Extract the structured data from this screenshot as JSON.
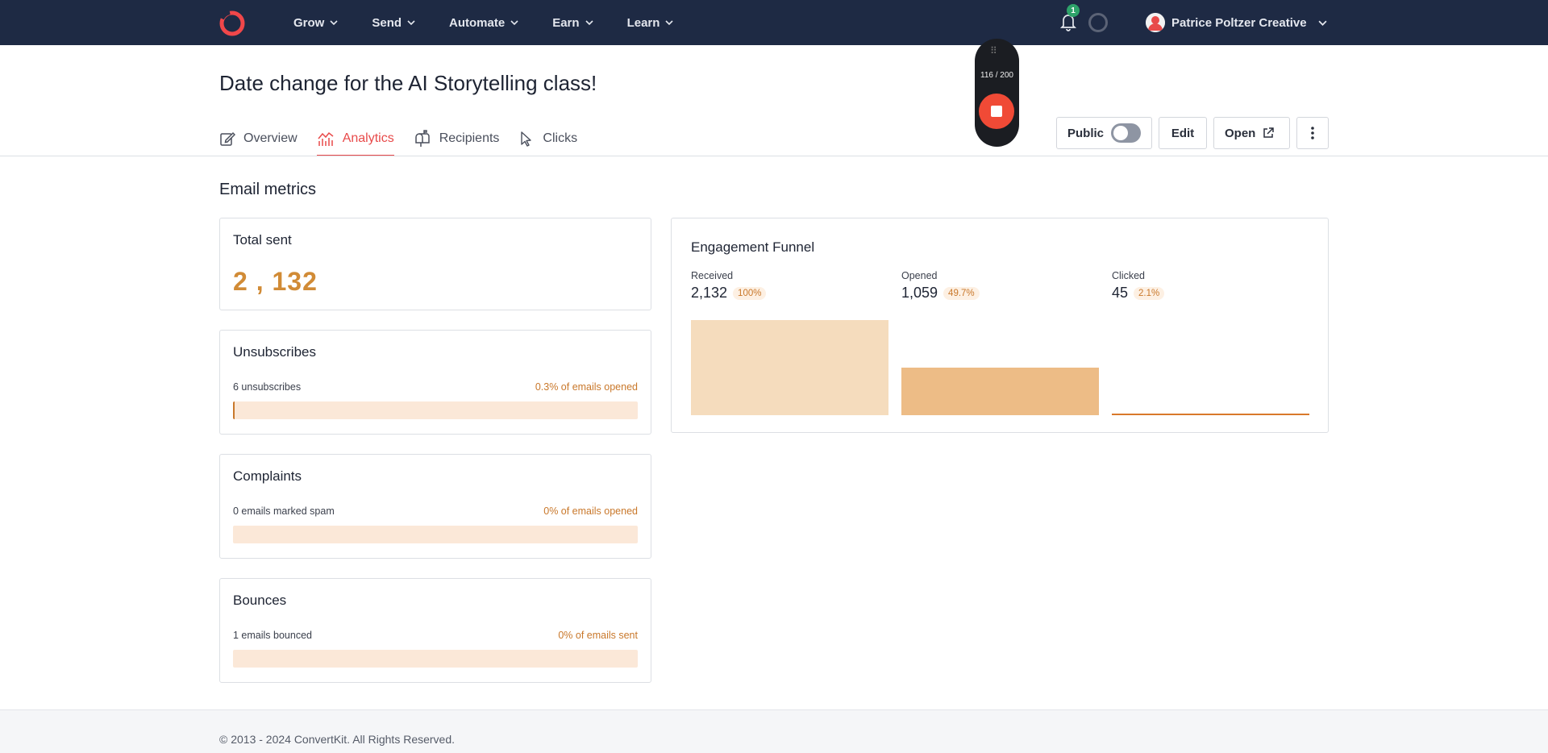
{
  "nav": {
    "items": [
      {
        "label": "Grow"
      },
      {
        "label": "Send"
      },
      {
        "label": "Automate"
      },
      {
        "label": "Earn"
      },
      {
        "label": "Learn"
      }
    ],
    "notification_count": "1",
    "user_name": "Patrice Poltzer Creative",
    "logo_icon": "convertkit-logo-icon"
  },
  "recorder": {
    "count": "116 / 200"
  },
  "header": {
    "title": "Date change for the AI Storytelling class!",
    "tabs": [
      {
        "label": "Overview",
        "icon": "edit-icon"
      },
      {
        "label": "Analytics",
        "icon": "analytics-icon",
        "active": true
      },
      {
        "label": "Recipients",
        "icon": "mailbox-icon"
      },
      {
        "label": "Clicks",
        "icon": "cursor-icon"
      }
    ],
    "public_label": "Public",
    "public_enabled": false,
    "edit_label": "Edit",
    "open_label": "Open"
  },
  "metrics": {
    "section_title": "Email metrics",
    "total_sent": {
      "title": "Total sent",
      "value": "2 , 132"
    },
    "unsubscribes": {
      "title": "Unsubscribes",
      "left": "6 unsubscribes",
      "right": "0.3% of emails opened",
      "fraction": 0.003
    },
    "complaints": {
      "title": "Complaints",
      "left": "0 emails marked spam",
      "right": "0% of emails opened",
      "fraction": 0
    },
    "bounces": {
      "title": "Bounces",
      "left": "1 emails bounced",
      "right": "0% of emails sent",
      "fraction": 0
    }
  },
  "funnel": {
    "title": "Engagement Funnel",
    "stages": [
      {
        "label": "Received",
        "value": "2,132",
        "pct": "100%",
        "fraction": 1.0,
        "color": "#f5dcbd"
      },
      {
        "label": "Opened",
        "value": "1,059",
        "pct": "49.7%",
        "fraction": 0.497,
        "color": "#edbc86"
      },
      {
        "label": "Clicked",
        "value": "45",
        "pct": "2.1%",
        "fraction": 0.021,
        "color": "#d9792b"
      }
    ]
  },
  "colors": {
    "nav_bg": "#1e2a44",
    "accent": "#e84a4a",
    "metric_orange": "#d18b36"
  },
  "footer": {
    "text": "© 2013 - 2024 ConvertKit. All Rights Reserved."
  }
}
